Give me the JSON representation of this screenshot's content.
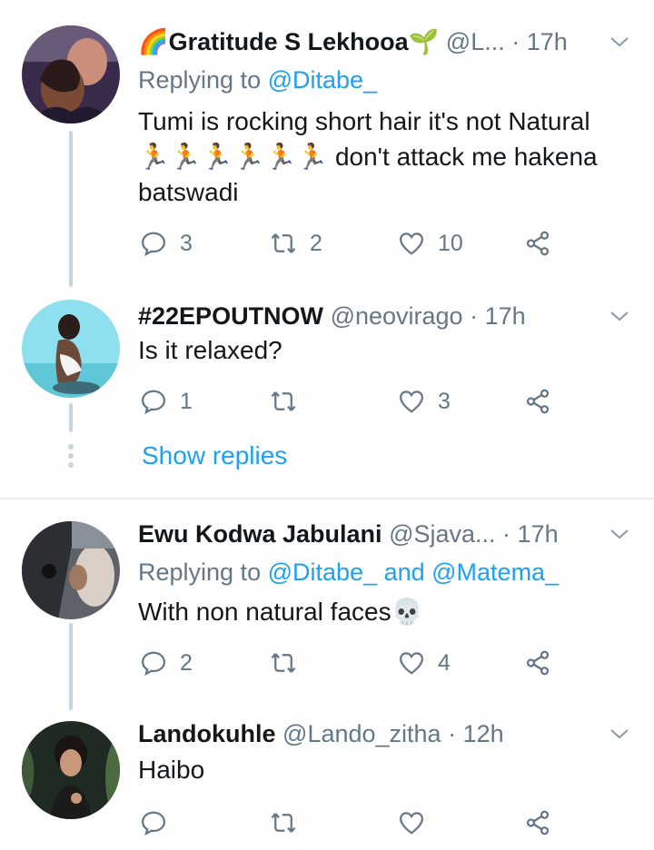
{
  "tweets": [
    {
      "name": "🌈Gratitude S Lekhooa🌱",
      "handle": "@L...",
      "time": "17h",
      "replying_prefix": "Replying to",
      "replying_to": "@Ditabe_",
      "text_line1": "Tumi is rocking short hair it's not Natural",
      "text_line2": "🏃🏃🏃🏃🏃🏃 don't  attack me hakena",
      "text_line3": "batswadi",
      "replies": "3",
      "retweets": "2",
      "likes": "10"
    },
    {
      "name": "#22EPOUTNOW",
      "handle": "@neovirago",
      "time": "17h",
      "text_line1": "Is it relaxed?",
      "replies": "1",
      "retweets": "",
      "likes": "3"
    },
    {
      "name": "Ewu Kodwa Jabulani",
      "handle": "@Sjava...",
      "time": "17h",
      "replying_prefix": "Replying to",
      "replying_to": "@Ditabe_ and @Matema_",
      "text_line1": "With non natural faces💀",
      "replies": "2",
      "retweets": "",
      "likes": "4"
    },
    {
      "name": "Landokuhle",
      "handle": "@Lando_zitha",
      "time": "12h",
      "text_line1": "Haibo",
      "replies": "",
      "retweets": "",
      "likes": ""
    }
  ],
  "show_replies": "Show replies",
  "colors": {
    "accent": "#1da1f2",
    "muted": "#657786",
    "line": "#c9d4dc"
  }
}
